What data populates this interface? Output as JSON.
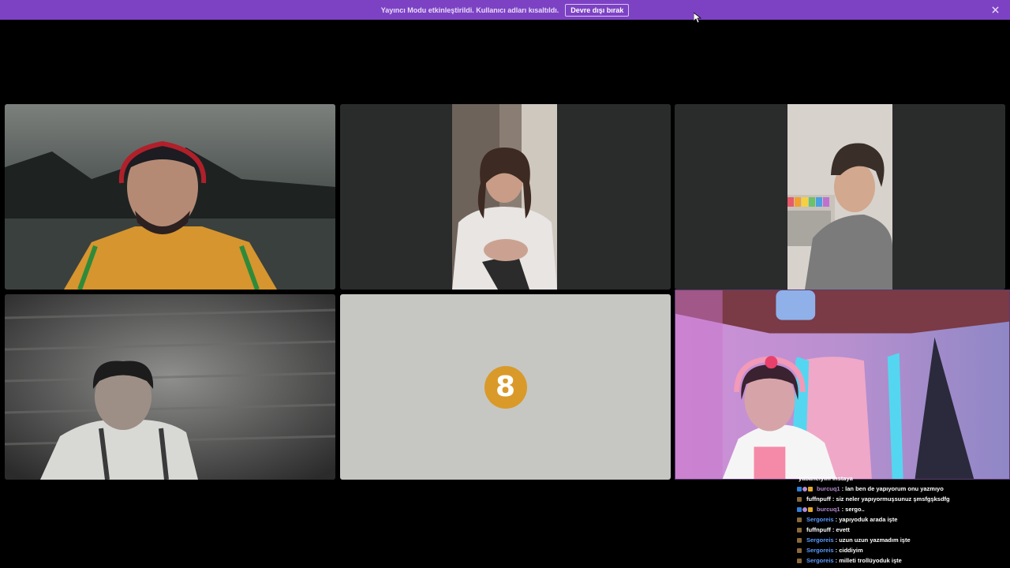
{
  "banner": {
    "message": "Yayıncı Modu etkinleştirildi. Kullanıcı adları kısaltıldı.",
    "button_label": "Devre dışı bırak",
    "background": "#7d42c4"
  },
  "tiles": [
    {
      "name": "participant-1",
      "kind": "video"
    },
    {
      "name": "participant-2",
      "kind": "video"
    },
    {
      "name": "participant-3",
      "kind": "video"
    },
    {
      "name": "participant-4",
      "kind": "video"
    },
    {
      "name": "participant-5",
      "kind": "avatar",
      "avatar_text": "8",
      "avatar_color": "#d99a2a"
    },
    {
      "name": "participant-6",
      "kind": "video"
    }
  ],
  "chat": {
    "partial_line": "yabancıyım instaya",
    "messages": [
      {
        "user": "burcuq1",
        "text": ": lan ben de yapıyorum onu yazmıyo",
        "color": "#b48bd0",
        "badges": [
          "vip",
          "mod",
          "gift"
        ]
      },
      {
        "user": "fuffnpuff",
        "text": ": siz neler yapıyormuşsunuz şmsfgşksdfg",
        "color": "#ffffff",
        "badges": [
          "sub"
        ]
      },
      {
        "user": "burcuq1",
        "text": ": sergo..",
        "color": "#b48bd0",
        "badges": [
          "vip",
          "mod",
          "gift"
        ]
      },
      {
        "user": "Sergoreis",
        "text": ": yapıyoduk arada işte",
        "color": "#5b9bff",
        "badges": [
          "sub"
        ]
      },
      {
        "user": "fuffnpuff",
        "text": ": evett",
        "color": "#ffffff",
        "badges": [
          "sub"
        ]
      },
      {
        "user": "Sergoreis",
        "text": ": uzun uzun yazmadım işte",
        "color": "#5b9bff",
        "badges": [
          "sub"
        ]
      },
      {
        "user": "Sergoreis",
        "text": ": ciddiyim",
        "color": "#5b9bff",
        "badges": [
          "sub"
        ]
      },
      {
        "user": "Sergoreis",
        "text": ": milleti trollüyoduk işte",
        "color": "#5b9bff",
        "badges": [
          "sub"
        ]
      }
    ]
  }
}
